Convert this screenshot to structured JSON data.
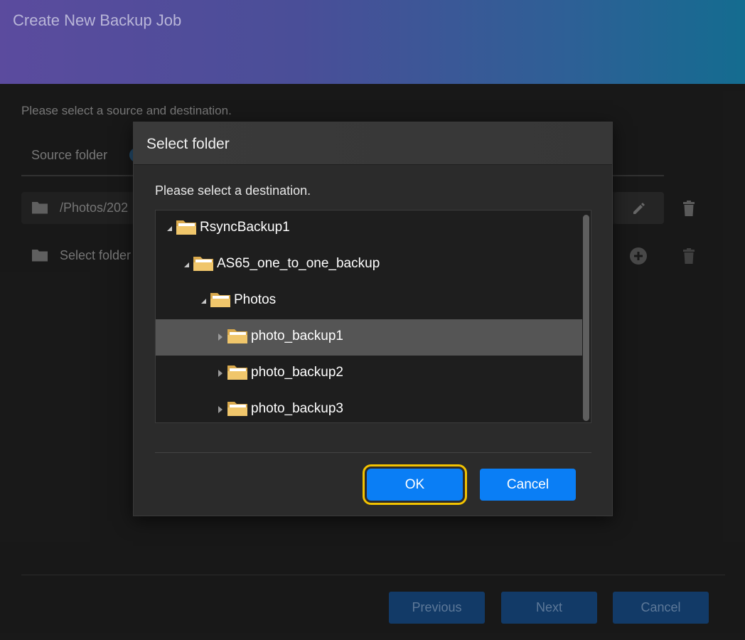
{
  "window": {
    "title": "Create New Backup Job"
  },
  "wizard": {
    "instructions": "Please select a source and destination.",
    "tab_source": "Source folder",
    "rows": [
      {
        "path": "/Photos/202"
      },
      {
        "path": "Select folder"
      }
    ],
    "footer": {
      "previous": "Previous",
      "next": "Next",
      "cancel": "Cancel"
    }
  },
  "dialog": {
    "title": "Select folder",
    "prompt": "Please select a destination.",
    "tree": [
      {
        "label": "RsyncBackup1",
        "level": 0,
        "expanded": true,
        "selected": false
      },
      {
        "label": "AS65_one_to_one_backup",
        "level": 1,
        "expanded": true,
        "selected": false
      },
      {
        "label": "Photos",
        "level": 2,
        "expanded": true,
        "selected": false
      },
      {
        "label": "photo_backup1",
        "level": 3,
        "expanded": false,
        "selected": true
      },
      {
        "label": "photo_backup2",
        "level": 3,
        "expanded": false,
        "selected": false
      },
      {
        "label": "photo_backup3",
        "level": 3,
        "expanded": false,
        "selected": false
      }
    ],
    "ok": "OK",
    "cancel": "Cancel"
  },
  "colors": {
    "accent": "#0a7ef5",
    "focus_ring": "#f2c200",
    "folder": "#f0c66b",
    "selected_row": "#555555"
  },
  "icons": [
    "folder-icon",
    "edit-icon",
    "trash-icon",
    "add-circle-icon",
    "expand-arrow-icon",
    "collapse-arrow-icon"
  ]
}
